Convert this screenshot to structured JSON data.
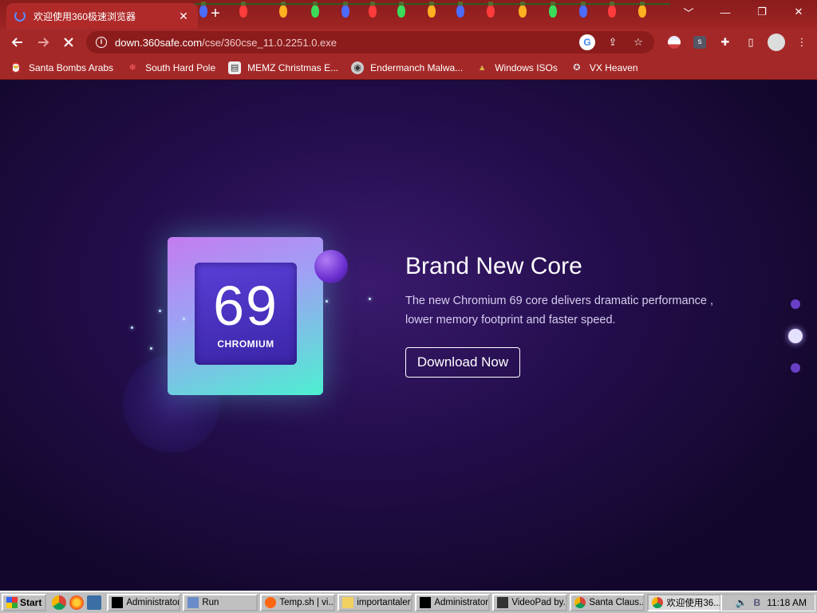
{
  "browser": {
    "tab_title": "欢迎使用360极速浏览器",
    "tab_close": "✕",
    "new_tab": "+",
    "url_host": "down.360safe.com",
    "url_path": "/cse/360cse_11.0.2251.0.exe",
    "window_buttons": [
      "﹀",
      "—",
      "❐",
      "✕"
    ]
  },
  "bookmarks": [
    {
      "label": "Santa Bombs Arabs",
      "icon": "santa-icon"
    },
    {
      "label": "South Hard Pole",
      "icon": "snowflake-icon"
    },
    {
      "label": "MEMZ Christmas E...",
      "icon": "memz-icon"
    },
    {
      "label": "Endermanch Malwa...",
      "icon": "raccoon-icon"
    },
    {
      "label": "Windows ISOs",
      "icon": "tree-icon"
    },
    {
      "label": "VX Heaven",
      "icon": "vx-icon"
    }
  ],
  "hero": {
    "chip_number": "69",
    "chip_label": "CHROMIUM",
    "headline": "Brand New Core",
    "description": "The new Chromium 69 core delivers dramatic performance , lower memory footprint and faster speed.",
    "download_label": "Download Now"
  },
  "taskbar": {
    "start_label": "Start",
    "items": [
      {
        "label": "Administrator...",
        "icon": "cmd-icon",
        "active": false
      },
      {
        "label": "Run",
        "icon": "run-icon",
        "active": false
      },
      {
        "label": "Temp.sh | vi...",
        "icon": "firefox-icon",
        "active": false
      },
      {
        "label": "importantalert",
        "icon": "folder-icon",
        "active": false
      },
      {
        "label": "Administrator...",
        "icon": "cmd-icon",
        "active": false
      },
      {
        "label": "VideoPad by...",
        "icon": "videopad-icon",
        "active": false
      },
      {
        "label": "Santa Claus...",
        "icon": "chrome-icon",
        "active": false
      },
      {
        "label": "欢迎使用36...",
        "icon": "chrome-icon",
        "active": true
      }
    ],
    "clock": "11:18 AM"
  },
  "colors": {
    "chrome_red": "#a52828",
    "page_bg": "#220d4a",
    "accent_purple": "#6a3fc8"
  }
}
